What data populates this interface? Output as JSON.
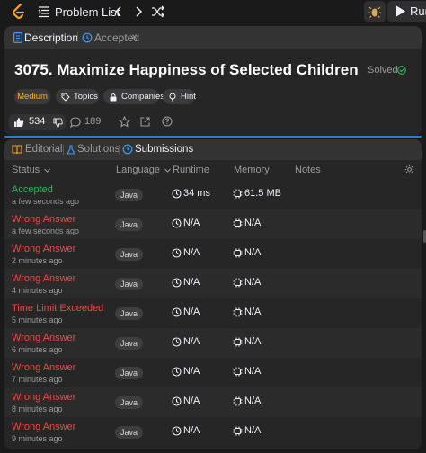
{
  "topbar": {
    "problem_list_label": "Problem List",
    "run_label": "Run"
  },
  "description_panel": {
    "tabs": [
      {
        "label": "Description",
        "icon": "document-icon",
        "active": true
      },
      {
        "label": "Accepted",
        "icon": "history-icon",
        "active": false,
        "closable": true
      }
    ],
    "close_glyph": "×",
    "title": "3075. Maximize Happiness of Selected Children",
    "solved_label": "Solved",
    "chips": [
      {
        "label": "Medium",
        "color": "#ffb800"
      },
      {
        "label": "Topics",
        "icon": "tag-icon"
      },
      {
        "label": "Companies",
        "icon": "lock-icon"
      },
      {
        "label": "Hint",
        "icon": "lightbulb-icon"
      }
    ],
    "likes": "534",
    "comments": "189"
  },
  "submissions_panel": {
    "tabs": [
      {
        "label": "Editorial",
        "icon": "book-icon",
        "active": false
      },
      {
        "label": "Solutions",
        "icon": "flask-icon",
        "active": false
      },
      {
        "label": "Submissions",
        "icon": "history-icon",
        "active": true
      }
    ],
    "columns": {
      "status": "Status",
      "language": "Language",
      "runtime": "Runtime",
      "memory": "Memory",
      "notes": "Notes"
    },
    "rows": [
      {
        "status": "Accepted",
        "time": "a few seconds ago",
        "language": "Java",
        "runtime": "34 ms",
        "memory": "61.5 MB",
        "color": "#2cbb5d"
      },
      {
        "status": "Wrong Answer",
        "time": "a few seconds ago",
        "language": "Java",
        "runtime": "N/A",
        "memory": "N/A",
        "color": "#ef4743"
      },
      {
        "status": "Wrong Answer",
        "time": "2 minutes ago",
        "language": "Java",
        "runtime": "N/A",
        "memory": "N/A",
        "color": "#ef4743"
      },
      {
        "status": "Wrong Answer",
        "time": "4 minutes ago",
        "language": "Java",
        "runtime": "N/A",
        "memory": "N/A",
        "color": "#ef4743"
      },
      {
        "status": "Time Limit Exceeded",
        "time": "5 minutes ago",
        "language": "Java",
        "runtime": "N/A",
        "memory": "N/A",
        "color": "#ef4743"
      },
      {
        "status": "Wrong Answer",
        "time": "6 minutes ago",
        "language": "Java",
        "runtime": "N/A",
        "memory": "N/A",
        "color": "#ef4743"
      },
      {
        "status": "Wrong Answer",
        "time": "7 minutes ago",
        "language": "Java",
        "runtime": "N/A",
        "memory": "N/A",
        "color": "#ef4743"
      },
      {
        "status": "Wrong Answer",
        "time": "8 minutes ago",
        "language": "Java",
        "runtime": "N/A",
        "memory": "N/A",
        "color": "#ef4743"
      },
      {
        "status": "Wrong Answer",
        "time": "9 minutes ago",
        "language": "Java",
        "runtime": "N/A",
        "memory": "N/A",
        "color": "#ef4743"
      }
    ]
  }
}
